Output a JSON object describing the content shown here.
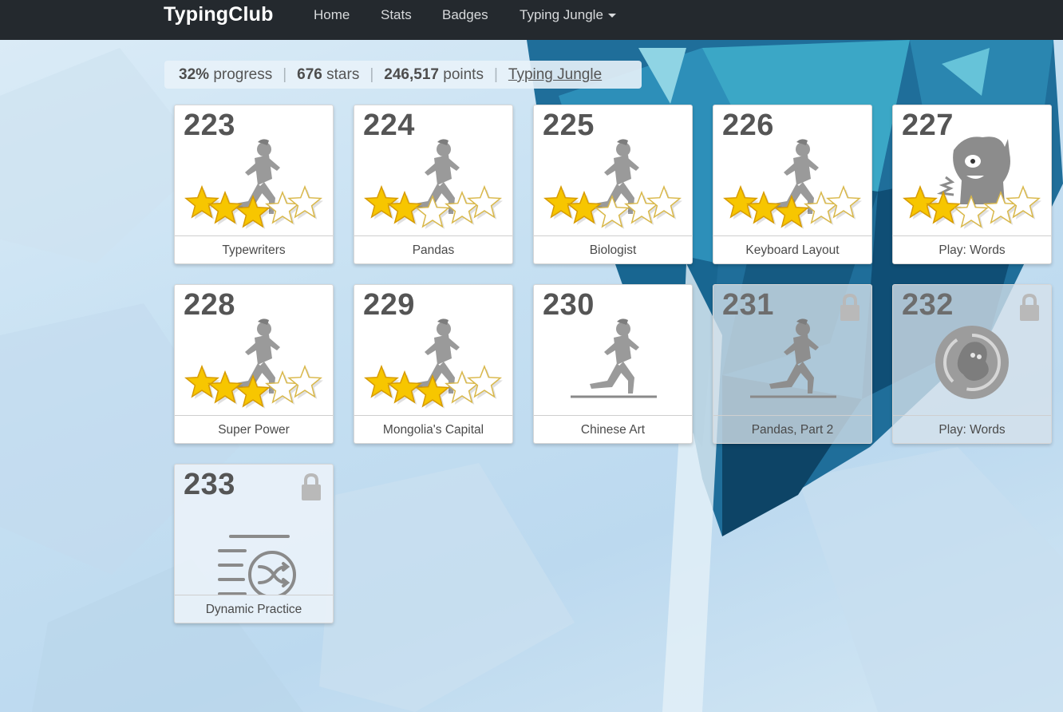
{
  "nav": {
    "brand": "TypingClub",
    "links": [
      "Home",
      "Stats",
      "Badges",
      "Typing Jungle"
    ]
  },
  "summary": {
    "progress_value": "32%",
    "progress_label": "progress",
    "stars_value": "676",
    "stars_label": "stars",
    "points_value": "246,517",
    "points_label": "points",
    "separator": "|",
    "course_link": "Typing Jungle"
  },
  "colors": {
    "nav_bg": "#24292e",
    "star_gold": "#f7c600",
    "star_empty": "#ffffff",
    "figure_gray": "#9a9a9a"
  },
  "lessons": [
    {
      "number": "223",
      "title": "Typewriters",
      "stars": 3,
      "icon": "runner-icon",
      "locked": false
    },
    {
      "number": "224",
      "title": "Pandas",
      "stars": 2,
      "icon": "runner-icon",
      "locked": false
    },
    {
      "number": "225",
      "title": "Biologist",
      "stars": 2,
      "icon": "runner-icon",
      "locked": false
    },
    {
      "number": "226",
      "title": "Keyboard Layout",
      "stars": 3,
      "icon": "runner-icon",
      "locked": false
    },
    {
      "number": "227",
      "title": "Play: Words",
      "stars": 2,
      "icon": "monster-icon",
      "locked": false
    },
    {
      "number": "228",
      "title": "Super Power",
      "stars": 3,
      "icon": "runner-icon",
      "locked": false
    },
    {
      "number": "229",
      "title": "Mongolia's Capital",
      "stars": 3,
      "icon": "runner-icon",
      "locked": false
    },
    {
      "number": "230",
      "title": "Chinese Art",
      "stars": 0,
      "icon": "runner-icon",
      "locked": false
    },
    {
      "number": "231",
      "title": "Pandas, Part 2",
      "stars": 0,
      "icon": "runner-icon",
      "locked": true
    },
    {
      "number": "232",
      "title": "Play: Words",
      "stars": 0,
      "icon": "game-icon",
      "locked": true
    },
    {
      "number": "233",
      "title": "Dynamic Practice",
      "stars": 0,
      "icon": "shuffle-list-icon",
      "locked": true
    }
  ]
}
